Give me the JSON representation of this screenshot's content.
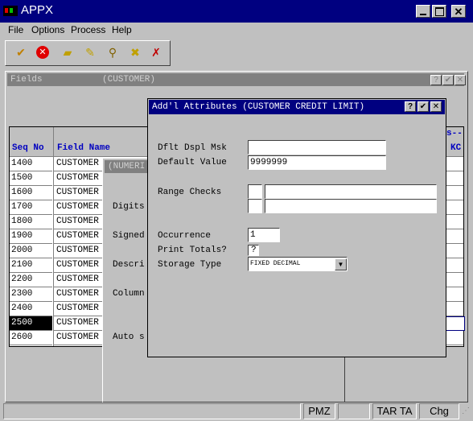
{
  "app": {
    "title": "APPX"
  },
  "menu": {
    "file": "File",
    "options": "Options",
    "process": "Process",
    "help": "Help"
  },
  "toolbar": {
    "icons": [
      "check-icon",
      "cancel-icon",
      "new-icon",
      "edit-icon",
      "search-icon",
      "delete-icon"
    ]
  },
  "fields_window": {
    "title": "Fields",
    "subtitle": "(CUSTOMER)",
    "header_seq": "Seq No",
    "header_field": "Field Name",
    "header_right1": "s--",
    "header_right2": "KC",
    "rows": [
      {
        "seq": "1400",
        "name": "CUSTOMER"
      },
      {
        "seq": "1500",
        "name": "CUSTOMER"
      },
      {
        "seq": "1600",
        "name": "CUSTOMER"
      },
      {
        "seq": "1700",
        "name": "CUSTOMER"
      },
      {
        "seq": "1800",
        "name": "CUSTOMER"
      },
      {
        "seq": "1900",
        "name": "CUSTOMER"
      },
      {
        "seq": "2000",
        "name": "CUSTOMER"
      },
      {
        "seq": "2100",
        "name": "CUSTOMER"
      },
      {
        "seq": "2200",
        "name": "CUSTOMER"
      },
      {
        "seq": "2300",
        "name": "CUSTOMER"
      },
      {
        "seq": "2400",
        "name": "CUSTOMER"
      },
      {
        "seq": "2500",
        "name": "CUSTOMER"
      },
      {
        "seq": "2600",
        "name": "CUSTOMER"
      }
    ]
  },
  "numeric_window": {
    "title": "(NUMERI",
    "labels": {
      "digits": "Digits",
      "signed": "Signed",
      "descr": "Descri",
      "column": "Column",
      "auto": "Auto s"
    }
  },
  "dialog": {
    "title": "Add'l Attributes (CUSTOMER CREDIT LIMIT)",
    "help_label": "?",
    "dflt_dspl_msk_label": "Dflt Dspl Msk",
    "dflt_dspl_msk_value": "",
    "default_value_label": "Default Value",
    "default_value": "9999999",
    "range_checks_label": "Range Checks",
    "occurrence_label": "Occurrence",
    "occurrence_value": "1",
    "print_totals_label": "Print Totals?",
    "print_totals_value": "?",
    "storage_type_label": "Storage Type",
    "storage_type_value": "FIXED DECIMAL"
  },
  "status": {
    "p1": "",
    "p2": "",
    "pmz": "PMZ",
    "p4": "",
    "tar": "TAR TA",
    "chg": "Chg"
  }
}
